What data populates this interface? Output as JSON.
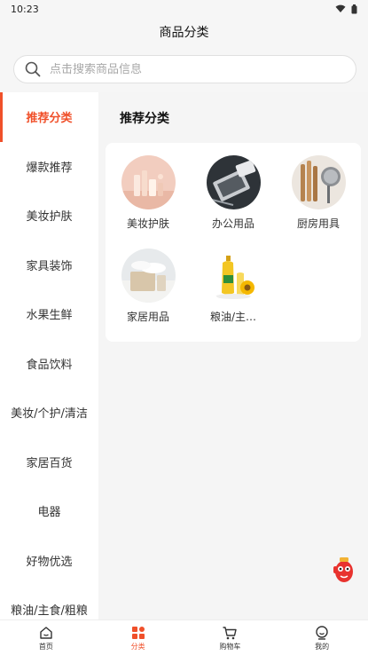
{
  "status_bar": {
    "time": "10:23"
  },
  "header": {
    "title": "商品分类"
  },
  "search": {
    "placeholder": "点击搜索商品信息",
    "value": ""
  },
  "sidebar": {
    "items": [
      {
        "label": "推荐分类",
        "active": true
      },
      {
        "label": "爆款推荐"
      },
      {
        "label": "美妆护肤"
      },
      {
        "label": "家具装饰"
      },
      {
        "label": "水果生鲜"
      },
      {
        "label": "食品饮料"
      },
      {
        "label": "美妆/个护/清洁"
      },
      {
        "label": "家居百货"
      },
      {
        "label": "电器"
      },
      {
        "label": "好物优选"
      },
      {
        "label": "粮油/主食/粗粮"
      }
    ]
  },
  "main": {
    "section_title": "推荐分类",
    "categories": [
      {
        "label": "美妆护肤",
        "icon": "cosmetics-image"
      },
      {
        "label": "办公用品",
        "icon": "office-supplies-image"
      },
      {
        "label": "厨房用具",
        "icon": "kitchenware-image"
      },
      {
        "label": "家居用品",
        "icon": "home-goods-image"
      },
      {
        "label": "粮油/主…",
        "icon": "grain-oil-image"
      }
    ]
  },
  "tab_bar": {
    "tabs": [
      {
        "label": "首页",
        "icon": "home-icon"
      },
      {
        "label": "分类",
        "icon": "category-icon",
        "active": true
      },
      {
        "label": "购物车",
        "icon": "cart-icon"
      },
      {
        "label": "我的",
        "icon": "profile-icon"
      }
    ]
  },
  "colors": {
    "accent": "#f0502a",
    "background": "#f5f5f5"
  }
}
